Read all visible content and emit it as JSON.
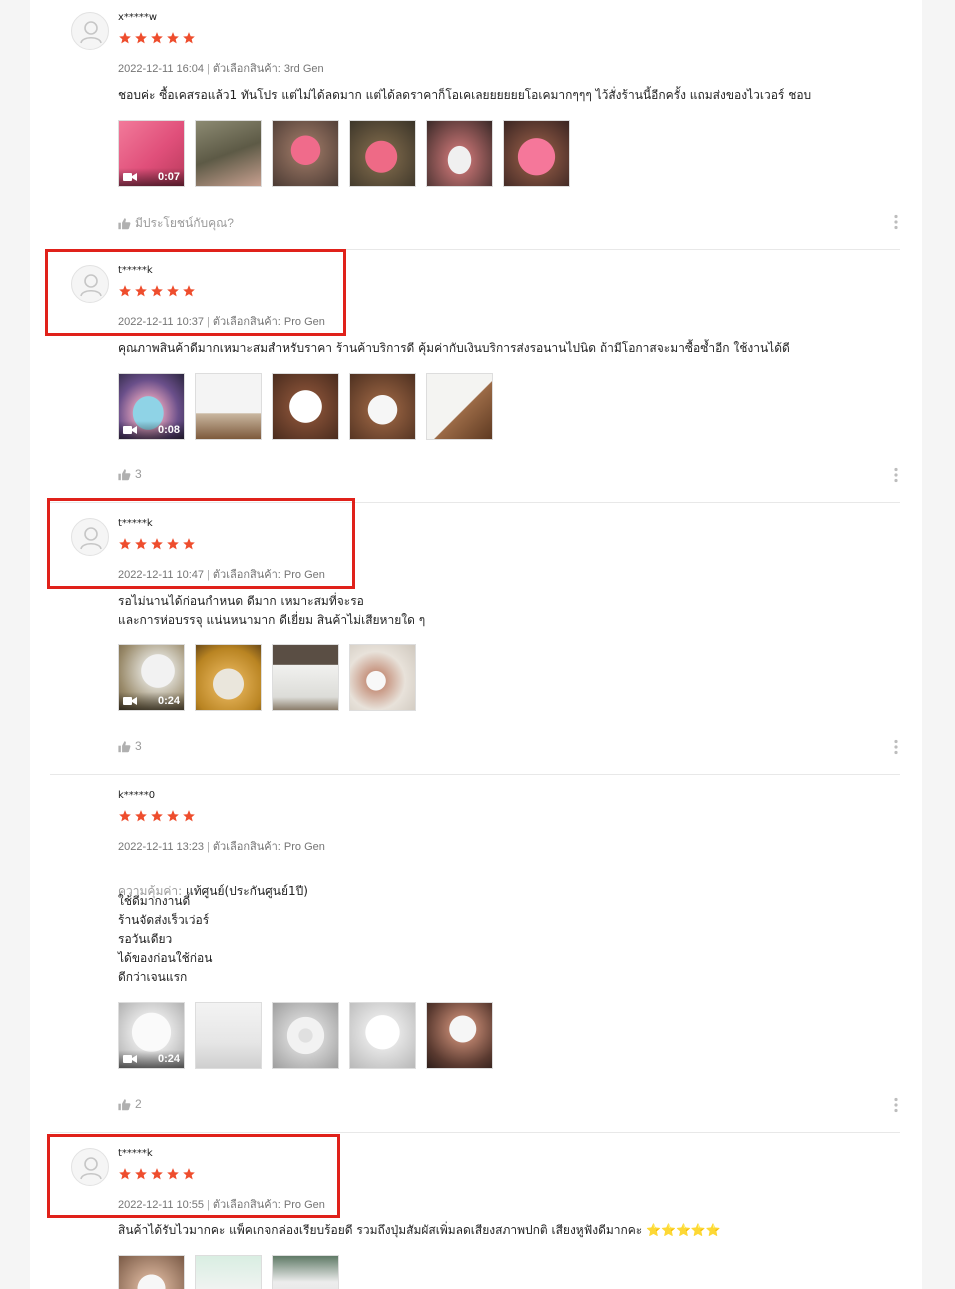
{
  "reviews": [
    {
      "author": "x*****w",
      "rating": 5,
      "date": "2022-12-11 16:04",
      "variant_label": "ตัวเลือกสินค้า:",
      "variant": "3rd Gen",
      "text": "ชอบค่ะ ซื้อเคสรอแล้ว1 ทันโปร แต่ไม่ได้ลดมาก แต่ได้ลดราคาก็โอเคเลยยยยยยโอเคมากๆๆๆ ไว้สั่งร้านนี้อีกครั้ง แถมส่งของไวเวอร์ ชอบ",
      "video_duration": "0:07",
      "likes": "มีประโยชน์กับคุณ?"
    },
    {
      "author": "t*****k",
      "rating": 5,
      "date": "2022-12-11 10:37",
      "variant_label": "ตัวเลือกสินค้า:",
      "variant": "Pro Gen",
      "text": "คุณภาพสินค้าดีมากเหมาะสมสำหรับราคา ร้านค้าบริการดี  คุ้มค่ากับเงินบริการส่งรอนานไปนิด  ถ้ามีโอกาสจะมาซื้อซ้ำอีก ใช้งานได้ดี",
      "video_duration": "0:08",
      "likes": "3"
    },
    {
      "author": "t*****k",
      "rating": 5,
      "date": "2022-12-11 10:47",
      "variant_label": "ตัวเลือกสินค้า:",
      "variant": "Pro Gen",
      "text": "รอไม่นานได้ก่อนกำหนด ดีมาก เหมาะสมที่จะรอ\nและการห่อบรรจุ แน่นหนามาก ดีเยี่ยม สินค้าไม่เสียหายใด ๆ",
      "video_duration": "0:24",
      "likes": "3"
    },
    {
      "author": "k*****0",
      "rating": 5,
      "date": "2022-12-11 13:23",
      "variant_label": "ตัวเลือกสินค้า:",
      "variant": "Pro Gen",
      "value_label": "ความคุ้มค่า:",
      "value_text": "แท้ศูนย์(ประกันศูนย์1ปี)",
      "text": "ใช้ดีมากงานดี\nร้านจัดส่งเร็วเว่อร์\nรอวันเดียว\nได้ของก่อนใช้ก่อน\nดีกว่าเจนแรก",
      "video_duration": "0:24",
      "likes": "2"
    },
    {
      "author": "t*****k",
      "rating": 5,
      "date": "2022-12-11 10:55",
      "variant_label": "ตัวเลือกสินค้า:",
      "variant": "Pro Gen",
      "text": "สินค้าได้รับไวมากคะ แพ็คเกจกล่องเรียบร้อยดี รวมถึงปุ่มสัมผัสเพิ่มลดเสียงสภาพปกติ เสียงหูฟังดีมากคะ ⭐⭐⭐⭐⭐"
    }
  ],
  "colors": {
    "star": "#ee4d2d",
    "highlight_box": "#e0211a",
    "text": "#222222",
    "muted": "#757575"
  }
}
